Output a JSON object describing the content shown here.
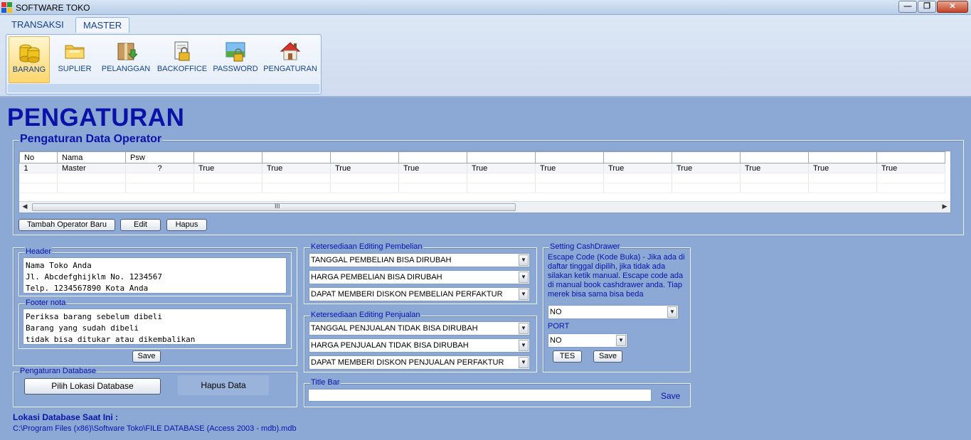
{
  "window": {
    "title": "SOFTWARE TOKO"
  },
  "tabs": [
    {
      "label": "TRANSAKSI"
    },
    {
      "label": "MASTER"
    }
  ],
  "ribbon": {
    "buttons": [
      {
        "label": "BARANG",
        "icon": "coins-icon"
      },
      {
        "label": "SUPLIER",
        "icon": "folder-icon"
      },
      {
        "label": "PELANGGAN",
        "icon": "box-icon"
      },
      {
        "label": "BACKOFFICE",
        "icon": "lock-document-icon"
      },
      {
        "label": "PASSWORD",
        "icon": "password-lock-icon"
      },
      {
        "label": "PENGATURAN",
        "icon": "house-icon"
      }
    ]
  },
  "page": {
    "title": "PENGATURAN"
  },
  "operator": {
    "legend": "Pengaturan Data Operator",
    "columns": [
      "No",
      "Nama",
      "Psw",
      "",
      "",
      "",
      "",
      "",
      "",
      "",
      "",
      "",
      "",
      ""
    ],
    "rows": [
      [
        "1",
        "Master",
        "?",
        "True",
        "True",
        "True",
        "True",
        "True",
        "True",
        "True",
        "True",
        "True",
        "True",
        "True"
      ]
    ],
    "add_label": "Tambah Operator Baru",
    "edit_label": "Edit",
    "delete_label": "Hapus"
  },
  "header_section": {
    "legend": "Header",
    "text": "Nama Toko Anda\nJl. Abcdefghijklm No. 1234567\nTelp. 1234567890 Kota Anda",
    "footer_legend": "Footer nota",
    "footer_text": "Periksa barang sebelum dibeli\nBarang yang sudah dibeli\ntidak bisa ditukar atau dikembalikan",
    "save_label": "Save"
  },
  "database": {
    "legend": "Pengaturan Database",
    "choose_label": "Pilih Lokasi Database",
    "delete_label": "Hapus Data",
    "location_title": "Lokasi Database Saat Ini :",
    "location_path": "C:\\Program Files (x86)\\Software Toko\\FILE DATABASE (Access 2003 - mdb).mdb"
  },
  "purchase": {
    "legend": "Ketersediaan Editing Pembelian",
    "options": [
      "TANGGAL PEMBELIAN BISA DIRUBAH",
      "HARGA PEMBELIAN BISA DIRUBAH",
      "DAPAT MEMBERI DISKON PEMBELIAN PERFAKTUR"
    ]
  },
  "sales": {
    "legend": "Ketersediaan Editing Penjualan",
    "options": [
      "TANGGAL PENJUALAN TIDAK BISA DIRUBAH",
      "HARGA PENJUALAN TIDAK BISA DIRUBAH",
      "DAPAT MEMBERI DISKON PENJUALAN PERFAKTUR"
    ]
  },
  "titlebar_section": {
    "legend": "Title Bar",
    "value": "",
    "save_label": "Save"
  },
  "cashdrawer": {
    "legend": "Setting CashDrawer",
    "description": "Escape Code (Kode Buka) - Jika ada di daftar tinggal dipilih, jika tidak ada silakan ketik manual. Escape code ada di manual book cashdrawer anda. Tiap merek bisa sama bisa beda",
    "escape_value": "NO",
    "port_label": "PORT",
    "port_value": "NO",
    "test_label": "TES",
    "save_label": "Save"
  },
  "colors": {
    "background": "#8ca9d6",
    "title": "#0a12a8",
    "ribbon_selected": "#fdd66c"
  }
}
